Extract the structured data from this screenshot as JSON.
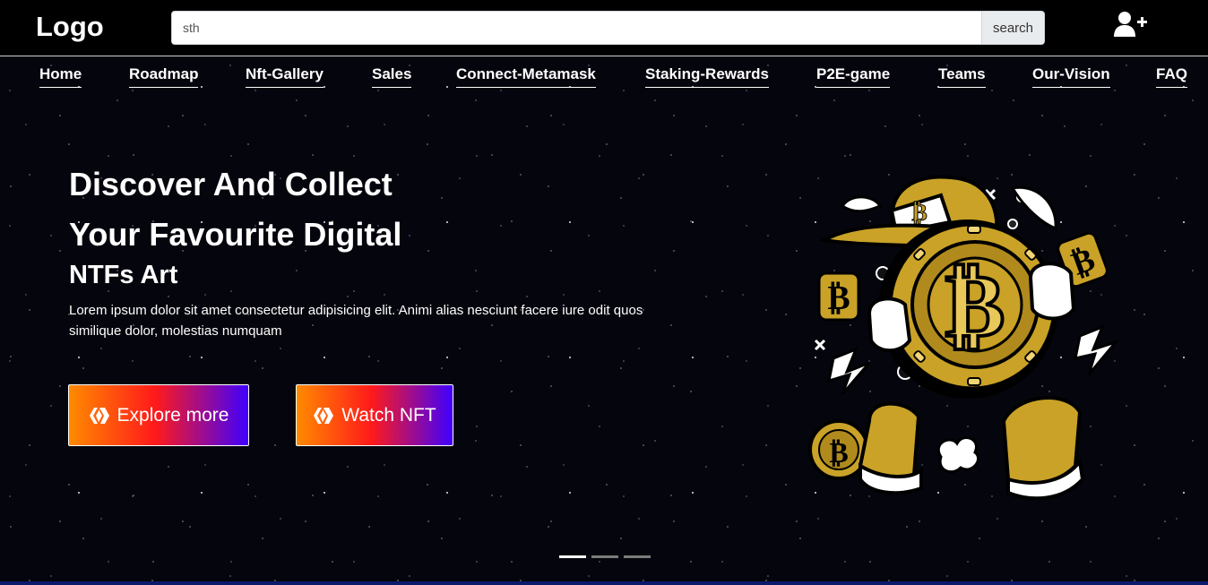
{
  "header": {
    "logo": "Logo",
    "search": {
      "value": "sth",
      "button_label": "search"
    },
    "user_icon": "user-plus-icon"
  },
  "nav": {
    "items": [
      {
        "label": "Home"
      },
      {
        "label": "Roadmap"
      },
      {
        "label": "Nft-Gallery"
      },
      {
        "label": "Sales"
      },
      {
        "label": "Connect-Metamask"
      },
      {
        "label": "Staking-Rewards"
      },
      {
        "label": "P2E-game"
      },
      {
        "label": "Teams"
      },
      {
        "label": "Our-Vision"
      },
      {
        "label": "FAQ"
      }
    ]
  },
  "hero": {
    "title_line1": "Discover And Collect",
    "title_line2": "Your Favourite Digital",
    "subtitle": "NTFs Art",
    "text": "Lorem ipsum dolor sit amet consectetur adipisicing elit. Animi alias nesciunt facere iure odit quos similique dolor, molestias numquam",
    "buttons": [
      {
        "label": "Explore more",
        "icon": "hive-icon"
      },
      {
        "label": "Watch NFT",
        "icon": "hive-icon"
      }
    ],
    "illustration": "bitcoin-mascot-illustration",
    "illustration_colors": {
      "gold": "#c9a227",
      "outline": "#000000",
      "white": "#ffffff"
    }
  },
  "carousel": {
    "slides": 3,
    "active": 1
  },
  "colors": {
    "gradient_start": "#ff8a00",
    "gradient_mid": "#ff1a1a",
    "gradient_end": "#3f00ff",
    "background": "#000000"
  }
}
